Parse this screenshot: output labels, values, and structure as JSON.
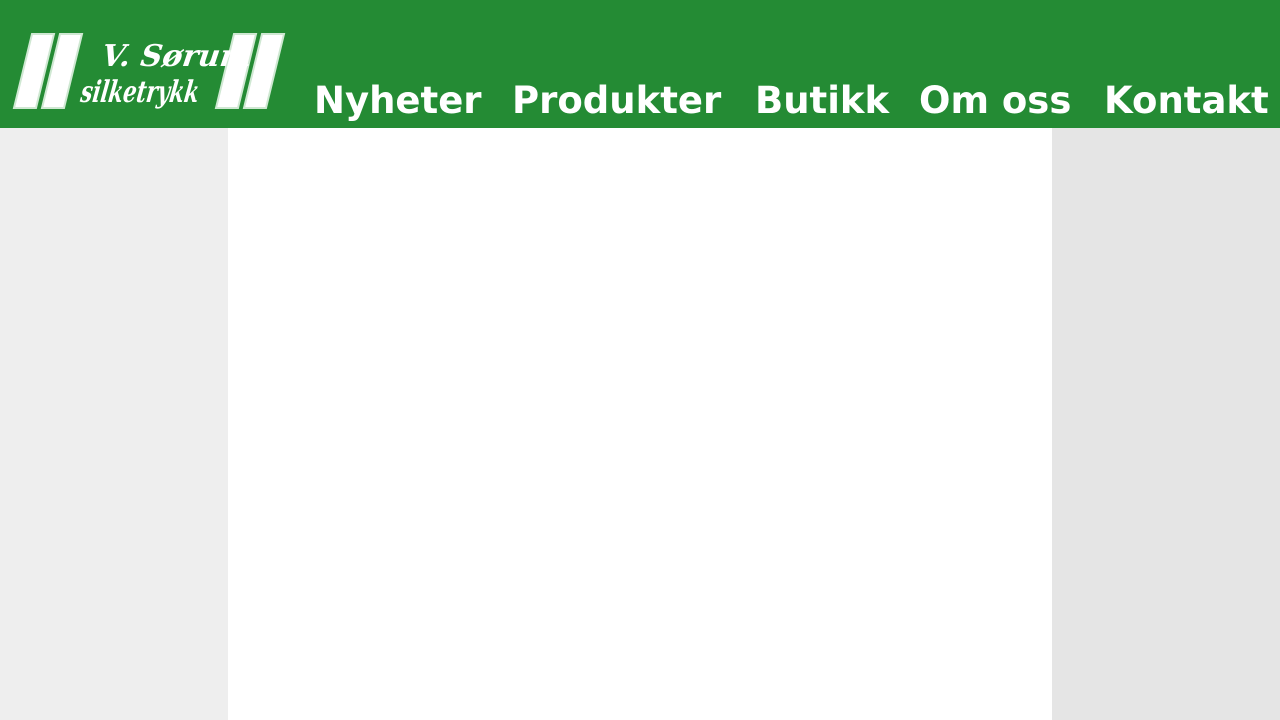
{
  "brand": {
    "logo_line1": "V. Sørum",
    "logo_line2": "silketrykk"
  },
  "nav": {
    "items": [
      {
        "label": "Nyheter"
      },
      {
        "label": "Produkter"
      },
      {
        "label": "Butikk"
      },
      {
        "label": "Om oss"
      },
      {
        "label": "Kontakt"
      }
    ]
  },
  "colors": {
    "header_bg": "#248b34",
    "nav_text": "#ffffff",
    "page_bg": "#eeeeee",
    "content_bg": "#ffffff"
  }
}
